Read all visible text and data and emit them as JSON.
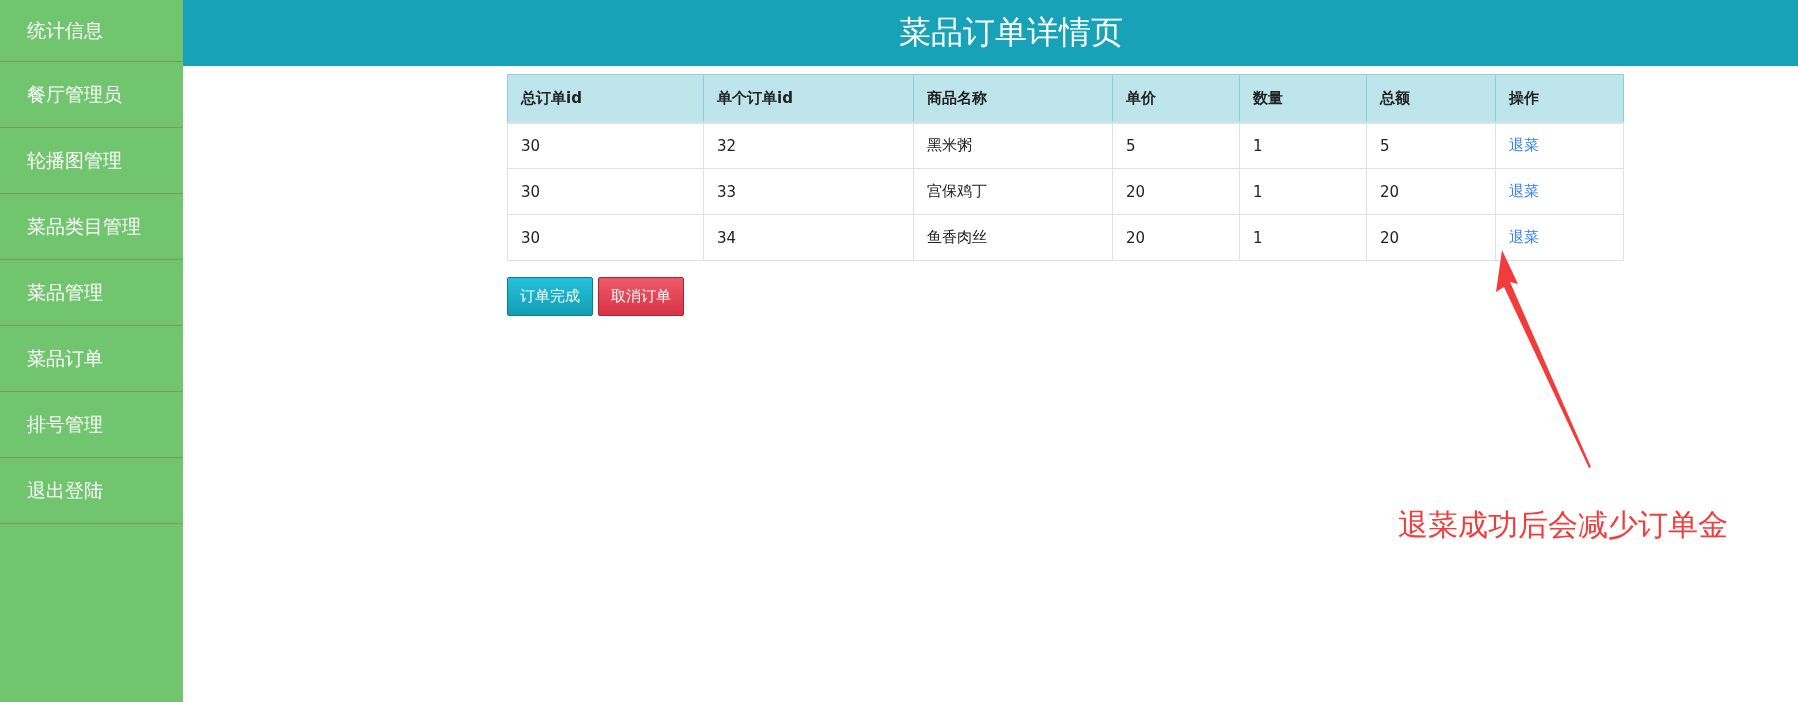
{
  "sidebar": {
    "items": [
      {
        "label": "统计信息"
      },
      {
        "label": "餐厅管理员"
      },
      {
        "label": "轮播图管理"
      },
      {
        "label": "菜品类目管理"
      },
      {
        "label": "菜品管理"
      },
      {
        "label": "菜品订单"
      },
      {
        "label": "排号管理"
      },
      {
        "label": "退出登陆"
      }
    ]
  },
  "header": {
    "title": "菜品订单详情页"
  },
  "table": {
    "columns": [
      "总订单id",
      "单个订单id",
      "商品名称",
      "单价",
      "数量",
      "总额",
      "操作"
    ],
    "rows": [
      {
        "order_id": "30",
        "item_id": "32",
        "name": "黑米粥",
        "price": "5",
        "quantity": "1",
        "total": "5",
        "action": "退菜"
      },
      {
        "order_id": "30",
        "item_id": "33",
        "name": "宫保鸡丁",
        "price": "20",
        "quantity": "1",
        "total": "20",
        "action": "退菜"
      },
      {
        "order_id": "30",
        "item_id": "34",
        "name": "鱼香肉丝",
        "price": "20",
        "quantity": "1",
        "total": "20",
        "action": "退菜"
      }
    ]
  },
  "buttons": [
    {
      "label": "订单完成",
      "kind": "complete"
    },
    {
      "label": "取消订单",
      "kind": "cancel"
    }
  ],
  "annotation": {
    "text": "退菜成功后会减少订单金"
  }
}
